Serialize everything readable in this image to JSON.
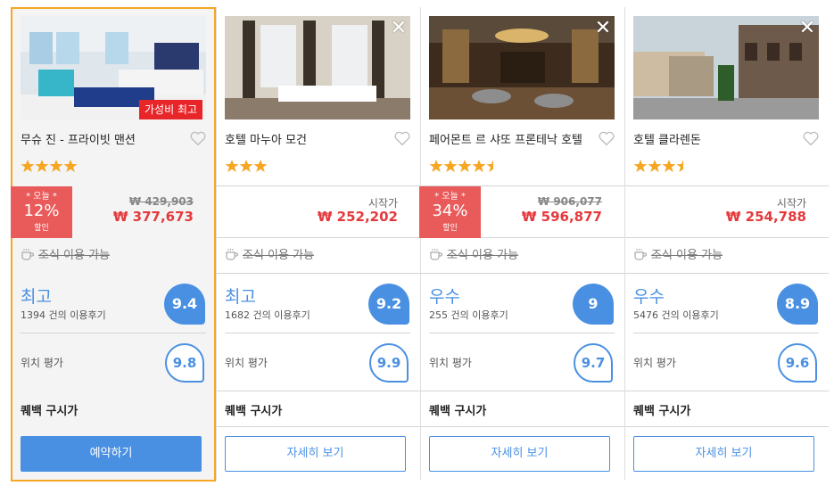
{
  "colors": {
    "accent": "#4a90e2",
    "price": "#e4393c",
    "deal": "#e95a5a",
    "selected_border": "#f5a623",
    "star": "#f5a623"
  },
  "hotels": [
    {
      "name": "무슈 진 - 프라이빗 맨션",
      "stars": 4,
      "badge": "가성비 최고",
      "deal": {
        "label": "* 오늘 *",
        "percent": "12%",
        "suffix": "할인"
      },
      "old_price": "₩ 429,903",
      "price": "₩ 377,673",
      "breakfast": "조식 이용 가능",
      "rating_word": "최고",
      "reviews": "1394 건의 이용후기",
      "score": "9.4",
      "location_label": "위치 평가",
      "location_score": "9.8",
      "cashback": "퀘백 구시가",
      "button": "예약하기",
      "selected": true
    },
    {
      "name": "호텔 마누아 모건",
      "stars": 3,
      "price_label": "시작가",
      "price": "₩ 252,202",
      "breakfast": "조식 이용 가능",
      "rating_word": "최고",
      "reviews": "1682 건의 이용후기",
      "score": "9.2",
      "location_label": "위치 평가",
      "location_score": "9.9",
      "cashback": "퀘백 구시가",
      "button": "자세히 보기",
      "selected": false
    },
    {
      "name": "페어몬트 르 샤또 프론테낙 호텔",
      "stars": 4.5,
      "deal": {
        "label": "* 오늘 *",
        "percent": "34%",
        "suffix": "할인"
      },
      "old_price": "₩ 906,077",
      "price": "₩ 596,877",
      "breakfast": "조식 이용 가능",
      "rating_word": "우수",
      "reviews": "255 건의 이용후기",
      "score": "9",
      "location_label": "위치 평가",
      "location_score": "9.7",
      "cashback": "퀘백 구시가",
      "button": "자세히 보기",
      "selected": false
    },
    {
      "name": "호텔 클라렌돈",
      "stars": 3.5,
      "price_label": "시작가",
      "price": "₩ 254,788",
      "breakfast": "조식 이용 가능",
      "rating_word": "우수",
      "reviews": "5476 건의 이용후기",
      "score": "8.9",
      "location_label": "위치 평가",
      "location_score": "9.6",
      "cashback": "퀘백 구시가",
      "button": "자세히 보기",
      "selected": false
    }
  ]
}
